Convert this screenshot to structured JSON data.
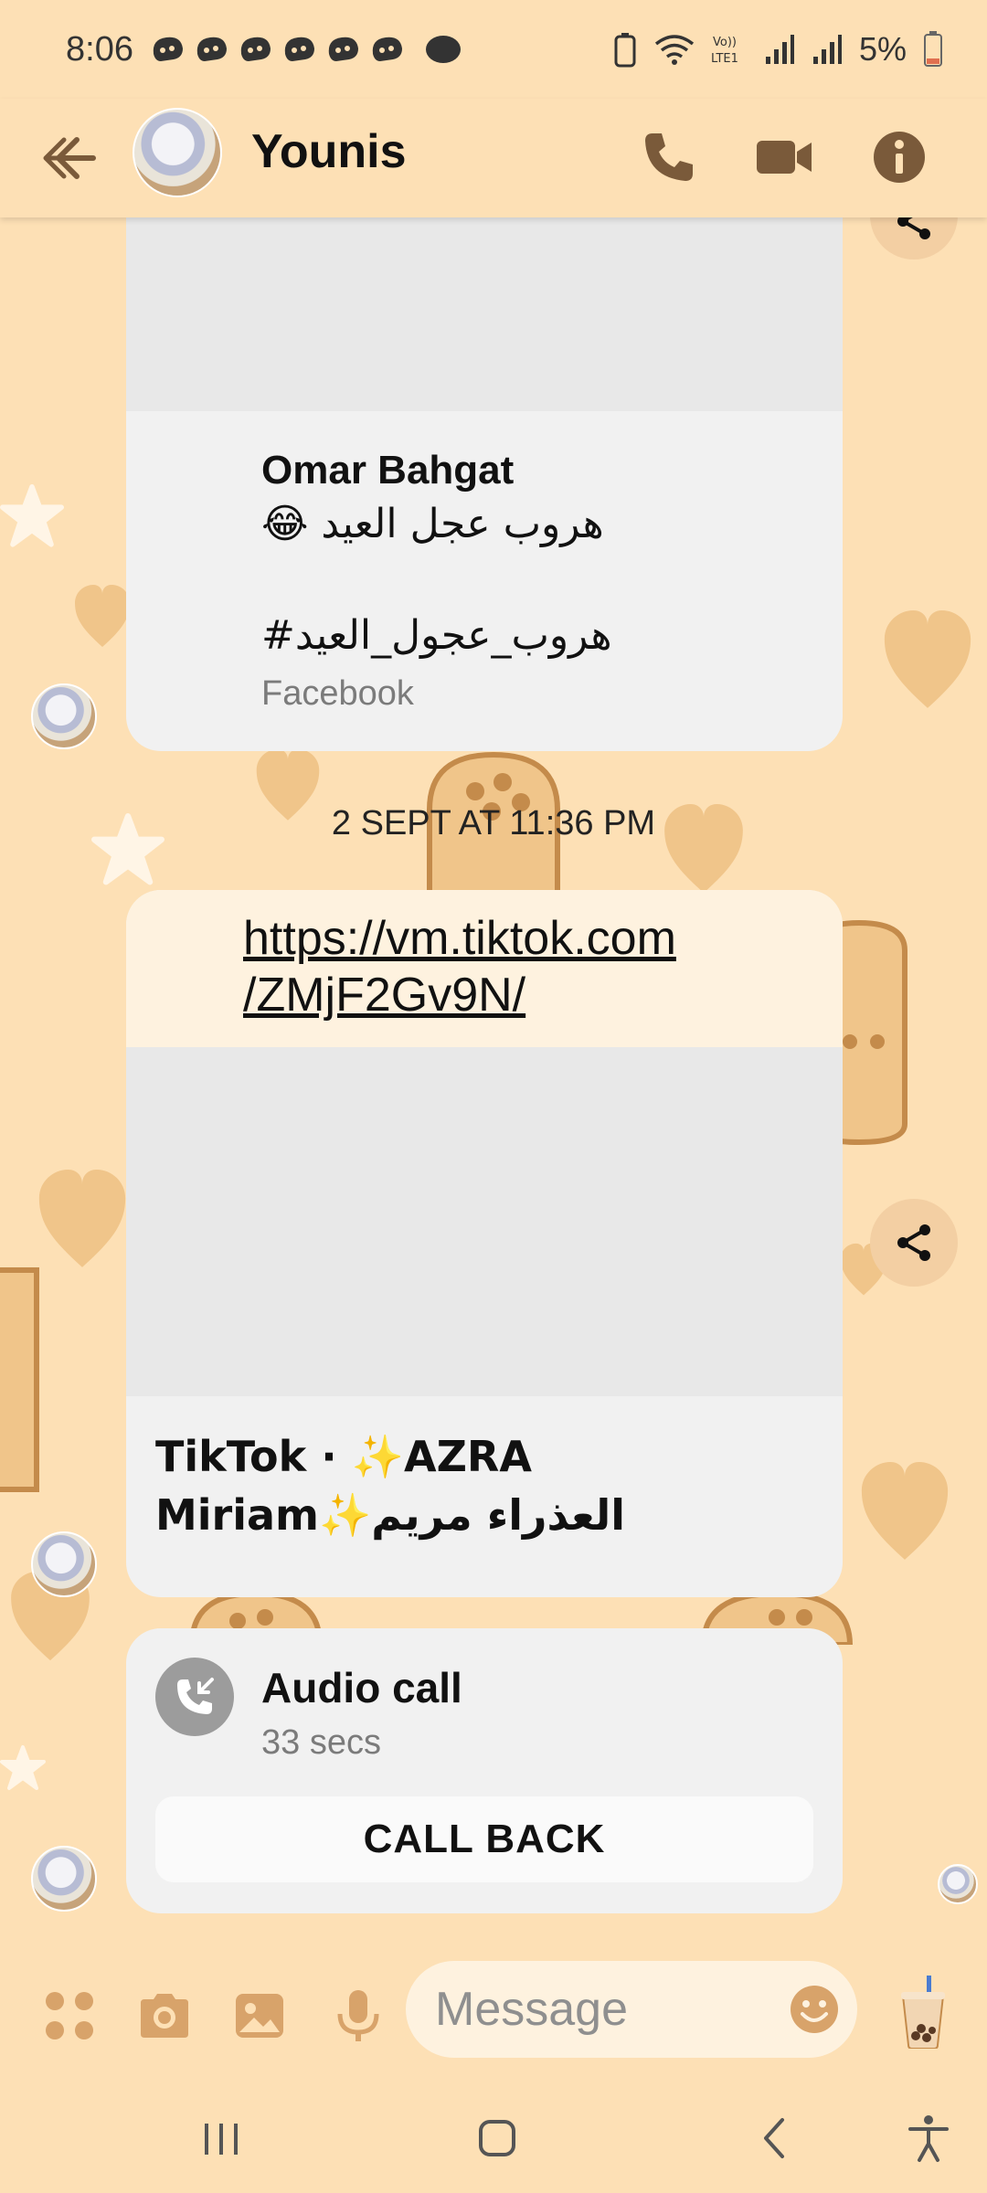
{
  "status_bar": {
    "time": "8:06",
    "battery": "5%",
    "icons": [
      "notification-icon",
      "wifi-icon",
      "volte-icon",
      "signal-icon",
      "battery-icon"
    ]
  },
  "header": {
    "contact_name": "Younis",
    "icons": [
      "back-arrow-icon",
      "phone-icon",
      "video-call-icon",
      "info-icon"
    ]
  },
  "messages": [
    {
      "type": "shared_post",
      "author": "Omar Bahgat",
      "text_line1": "😂 هروب عجل العيد",
      "text_line2": "#هروب_عجول_العيد",
      "source": "Facebook"
    },
    {
      "type": "timestamp",
      "text": "2 SEPT AT 11:36 PM"
    },
    {
      "type": "link",
      "url": "https://vm.tiktok.com/ZMjF2Gv9N/",
      "url_line1": "https://vm.tiktok.com",
      "url_line2": "/ZMjF2Gv9N/",
      "title": "TikTok · ✨AZRA Miriam✨العذراء مريم"
    },
    {
      "type": "call",
      "title": "Audio call",
      "duration": "33 secs",
      "action": "CALL BACK"
    }
  ],
  "composer": {
    "placeholder": "Message"
  },
  "colors": {
    "background": "#fde0b5",
    "bubble": "#f1f1f1",
    "accent": "#7a5a3a"
  }
}
